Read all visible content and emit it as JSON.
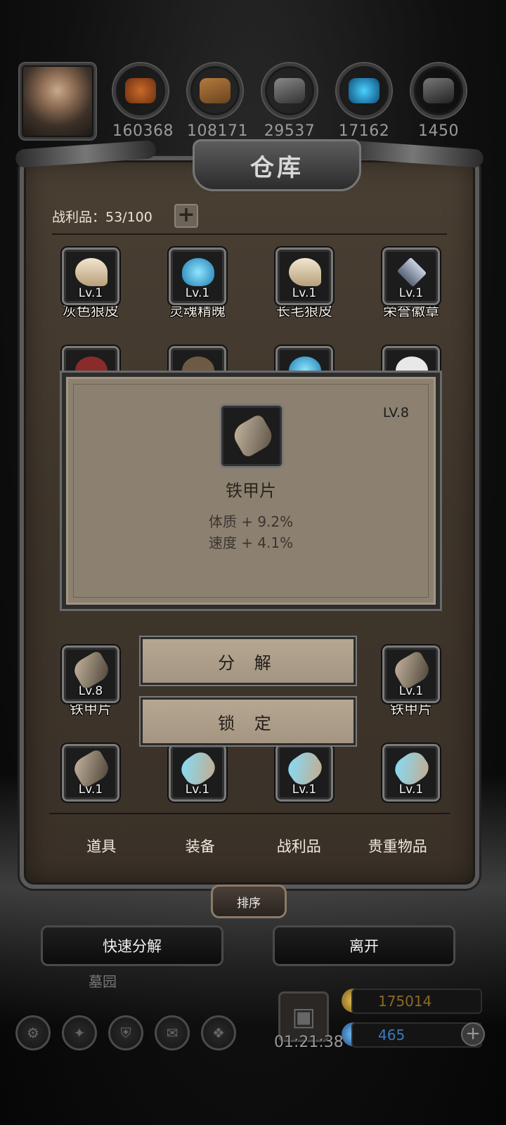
{
  "resources": [
    {
      "icon": "leather-icon",
      "value": "160368"
    },
    {
      "icon": "wood-icon",
      "value": "108171"
    },
    {
      "icon": "iron-icon",
      "value": "29537"
    },
    {
      "icon": "crystal-icon",
      "value": "17162"
    },
    {
      "icon": "ingot-icon",
      "value": "1450"
    }
  ],
  "window": {
    "title": "仓库",
    "capacity": "战利品：53/100",
    "plus": "+"
  },
  "grid_top": [
    {
      "name": "灰色狼皮",
      "level": "Lv.1",
      "icon": "claw-icon"
    },
    {
      "name": "灵魂精魄",
      "level": "Lv.1",
      "icon": "soul-crystal-icon"
    },
    {
      "name": "长毛狼皮",
      "level": "Lv.1",
      "icon": "claw-icon"
    },
    {
      "name": "荣誉徽章",
      "level": "Lv.1",
      "icon": "honor-badge-icon"
    }
  ],
  "grid_bottom": [
    {
      "name": "铁甲片",
      "level": "Lv.8",
      "icon": "iron-plate-icon"
    },
    {
      "name": "铁甲片",
      "level": "Lv.1",
      "icon": "iron-plate-icon"
    }
  ],
  "grid_last": [
    {
      "level": "Lv.1",
      "icon": "iron-plate-icon"
    },
    {
      "level": "Lv.1",
      "icon": "rune-stone-icon"
    },
    {
      "level": "Lv.1",
      "icon": "rune-stone-icon"
    },
    {
      "level": "Lv.1",
      "icon": "rune-stone-icon"
    }
  ],
  "popup": {
    "level": "LV.8",
    "item_name": "铁甲片",
    "stat1": "体质 + 9.2%",
    "stat2": "速度 + 4.1%",
    "icon": "iron-plate-icon"
  },
  "actions": {
    "decompose": "分 解",
    "lock": "锁 定"
  },
  "tabs": [
    "道具",
    "装备",
    "战利品",
    "贵重物品"
  ],
  "sort_label": "排序",
  "bottom": {
    "quick_decompose": "快速分解",
    "leave": "离开",
    "cemetery": "墓园",
    "timer": "01:21:38"
  },
  "currency": {
    "gold": "175014",
    "gems": "465",
    "gold_color": "#c9a53a",
    "gem_color": "#3a8ad0"
  },
  "colors": {
    "accent": "#8c8170"
  }
}
